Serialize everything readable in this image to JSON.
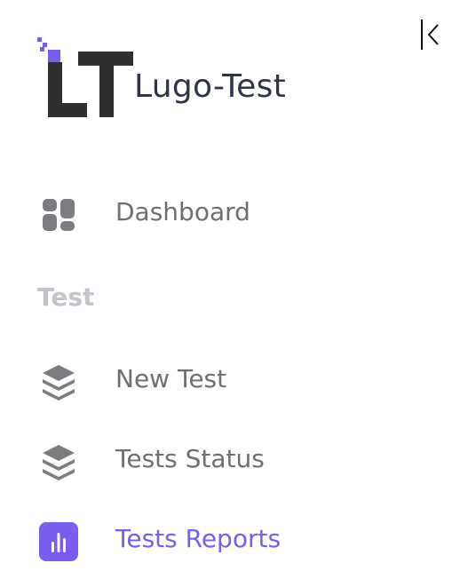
{
  "brand": {
    "name": "Lugo-Test",
    "logo_text": "LT",
    "logo_color": "#2f2f2f",
    "accent": "#7a5cf0"
  },
  "collapse": {
    "icon": "collapse-left-icon"
  },
  "nav": {
    "dashboard": {
      "label": "Dashboard",
      "icon": "dashboard-grid-icon",
      "active": false
    },
    "section_title": "Test",
    "items": [
      {
        "label": "New Test",
        "icon": "layers-icon",
        "active": false
      },
      {
        "label": "Tests Status",
        "icon": "layers-icon",
        "active": false
      },
      {
        "label": "Tests Reports",
        "icon": "bar-chart-icon",
        "active": true
      }
    ]
  },
  "colors": {
    "text_default": "#6e6e73",
    "icon_default": "#7b7b80",
    "section_title": "#c3c3cc",
    "active": "#7a5cf0"
  }
}
